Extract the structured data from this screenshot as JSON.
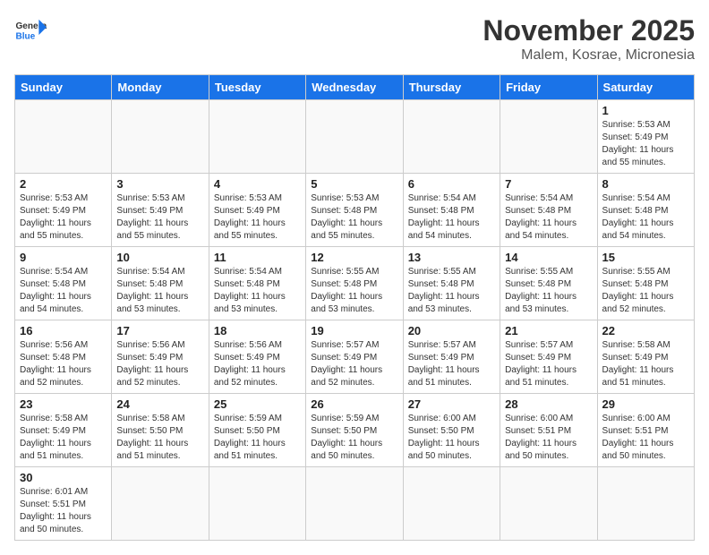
{
  "header": {
    "logo_general": "General",
    "logo_blue": "Blue",
    "title": "November 2025",
    "subtitle": "Malem, Kosrae, Micronesia"
  },
  "days_of_week": [
    "Sunday",
    "Monday",
    "Tuesday",
    "Wednesday",
    "Thursday",
    "Friday",
    "Saturday"
  ],
  "weeks": [
    [
      {
        "day": "",
        "info": ""
      },
      {
        "day": "",
        "info": ""
      },
      {
        "day": "",
        "info": ""
      },
      {
        "day": "",
        "info": ""
      },
      {
        "day": "",
        "info": ""
      },
      {
        "day": "",
        "info": ""
      },
      {
        "day": "1",
        "info": "Sunrise: 5:53 AM\nSunset: 5:49 PM\nDaylight: 11 hours\nand 55 minutes."
      }
    ],
    [
      {
        "day": "2",
        "info": "Sunrise: 5:53 AM\nSunset: 5:49 PM\nDaylight: 11 hours\nand 55 minutes."
      },
      {
        "day": "3",
        "info": "Sunrise: 5:53 AM\nSunset: 5:49 PM\nDaylight: 11 hours\nand 55 minutes."
      },
      {
        "day": "4",
        "info": "Sunrise: 5:53 AM\nSunset: 5:49 PM\nDaylight: 11 hours\nand 55 minutes."
      },
      {
        "day": "5",
        "info": "Sunrise: 5:53 AM\nSunset: 5:48 PM\nDaylight: 11 hours\nand 55 minutes."
      },
      {
        "day": "6",
        "info": "Sunrise: 5:54 AM\nSunset: 5:48 PM\nDaylight: 11 hours\nand 54 minutes."
      },
      {
        "day": "7",
        "info": "Sunrise: 5:54 AM\nSunset: 5:48 PM\nDaylight: 11 hours\nand 54 minutes."
      },
      {
        "day": "8",
        "info": "Sunrise: 5:54 AM\nSunset: 5:48 PM\nDaylight: 11 hours\nand 54 minutes."
      }
    ],
    [
      {
        "day": "9",
        "info": "Sunrise: 5:54 AM\nSunset: 5:48 PM\nDaylight: 11 hours\nand 54 minutes."
      },
      {
        "day": "10",
        "info": "Sunrise: 5:54 AM\nSunset: 5:48 PM\nDaylight: 11 hours\nand 53 minutes."
      },
      {
        "day": "11",
        "info": "Sunrise: 5:54 AM\nSunset: 5:48 PM\nDaylight: 11 hours\nand 53 minutes."
      },
      {
        "day": "12",
        "info": "Sunrise: 5:55 AM\nSunset: 5:48 PM\nDaylight: 11 hours\nand 53 minutes."
      },
      {
        "day": "13",
        "info": "Sunrise: 5:55 AM\nSunset: 5:48 PM\nDaylight: 11 hours\nand 53 minutes."
      },
      {
        "day": "14",
        "info": "Sunrise: 5:55 AM\nSunset: 5:48 PM\nDaylight: 11 hours\nand 53 minutes."
      },
      {
        "day": "15",
        "info": "Sunrise: 5:55 AM\nSunset: 5:48 PM\nDaylight: 11 hours\nand 52 minutes."
      }
    ],
    [
      {
        "day": "16",
        "info": "Sunrise: 5:56 AM\nSunset: 5:48 PM\nDaylight: 11 hours\nand 52 minutes."
      },
      {
        "day": "17",
        "info": "Sunrise: 5:56 AM\nSunset: 5:49 PM\nDaylight: 11 hours\nand 52 minutes."
      },
      {
        "day": "18",
        "info": "Sunrise: 5:56 AM\nSunset: 5:49 PM\nDaylight: 11 hours\nand 52 minutes."
      },
      {
        "day": "19",
        "info": "Sunrise: 5:57 AM\nSunset: 5:49 PM\nDaylight: 11 hours\nand 52 minutes."
      },
      {
        "day": "20",
        "info": "Sunrise: 5:57 AM\nSunset: 5:49 PM\nDaylight: 11 hours\nand 51 minutes."
      },
      {
        "day": "21",
        "info": "Sunrise: 5:57 AM\nSunset: 5:49 PM\nDaylight: 11 hours\nand 51 minutes."
      },
      {
        "day": "22",
        "info": "Sunrise: 5:58 AM\nSunset: 5:49 PM\nDaylight: 11 hours\nand 51 minutes."
      }
    ],
    [
      {
        "day": "23",
        "info": "Sunrise: 5:58 AM\nSunset: 5:49 PM\nDaylight: 11 hours\nand 51 minutes."
      },
      {
        "day": "24",
        "info": "Sunrise: 5:58 AM\nSunset: 5:50 PM\nDaylight: 11 hours\nand 51 minutes."
      },
      {
        "day": "25",
        "info": "Sunrise: 5:59 AM\nSunset: 5:50 PM\nDaylight: 11 hours\nand 51 minutes."
      },
      {
        "day": "26",
        "info": "Sunrise: 5:59 AM\nSunset: 5:50 PM\nDaylight: 11 hours\nand 50 minutes."
      },
      {
        "day": "27",
        "info": "Sunrise: 6:00 AM\nSunset: 5:50 PM\nDaylight: 11 hours\nand 50 minutes."
      },
      {
        "day": "28",
        "info": "Sunrise: 6:00 AM\nSunset: 5:51 PM\nDaylight: 11 hours\nand 50 minutes."
      },
      {
        "day": "29",
        "info": "Sunrise: 6:00 AM\nSunset: 5:51 PM\nDaylight: 11 hours\nand 50 minutes."
      }
    ],
    [
      {
        "day": "30",
        "info": "Sunrise: 6:01 AM\nSunset: 5:51 PM\nDaylight: 11 hours\nand 50 minutes."
      },
      {
        "day": "",
        "info": ""
      },
      {
        "day": "",
        "info": ""
      },
      {
        "day": "",
        "info": ""
      },
      {
        "day": "",
        "info": ""
      },
      {
        "day": "",
        "info": ""
      },
      {
        "day": "",
        "info": ""
      }
    ]
  ]
}
